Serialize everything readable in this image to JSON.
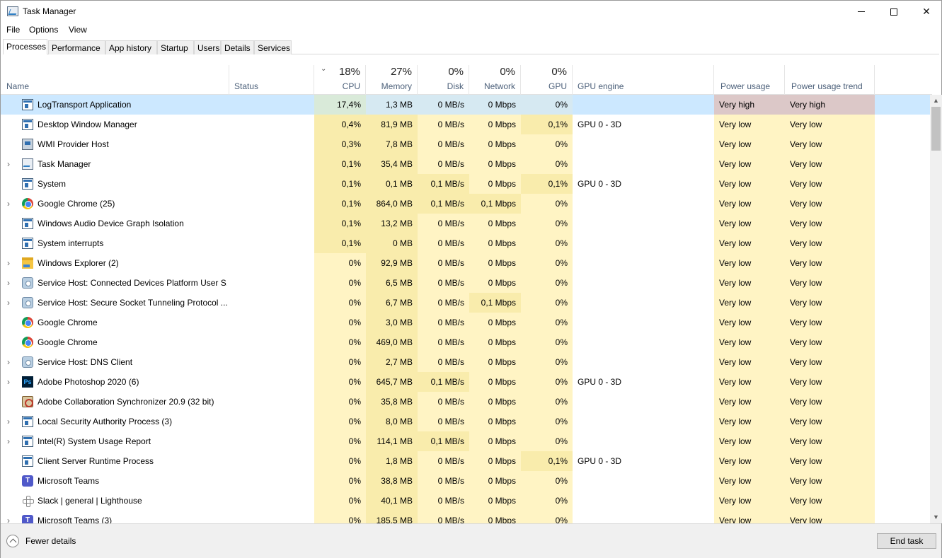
{
  "window": {
    "title": "Task Manager"
  },
  "menu": {
    "file": "File",
    "options": "Options",
    "view": "View"
  },
  "tabs": [
    "Processes",
    "Performance",
    "App history",
    "Startup",
    "Users",
    "Details",
    "Services"
  ],
  "header": {
    "name": "Name",
    "status": "Status",
    "cpu_pct": "18%",
    "cpu": "CPU",
    "memory_pct": "27%",
    "memory": "Memory",
    "disk_pct": "0%",
    "disk": "Disk",
    "network_pct": "0%",
    "network": "Network",
    "gpu_pct": "0%",
    "gpu": "GPU",
    "gpu_engine": "GPU engine",
    "power_usage": "Power usage",
    "power_usage_trend": "Power usage trend"
  },
  "processes": [
    {
      "name": "LogTransport Application",
      "icon": "app-icon",
      "expandable": false,
      "cpu": "17,4%",
      "memory": "1,3 MB",
      "disk": "0 MB/s",
      "network": "0 Mbps",
      "gpu": "0%",
      "gpu_engine": "",
      "power": "Very high",
      "trend": "Very high"
    },
    {
      "name": "Desktop Window Manager",
      "icon": "app-icon",
      "expandable": false,
      "cpu": "0,4%",
      "memory": "81,9 MB",
      "disk": "0 MB/s",
      "network": "0 Mbps",
      "gpu": "0,1%",
      "gpu_engine": "GPU 0 - 3D",
      "power": "Very low",
      "trend": "Very low"
    },
    {
      "name": "WMI Provider Host",
      "icon": "wmi-icon",
      "expandable": false,
      "cpu": "0,3%",
      "memory": "7,8 MB",
      "disk": "0 MB/s",
      "network": "0 Mbps",
      "gpu": "0%",
      "gpu_engine": "",
      "power": "Very low",
      "trend": "Very low"
    },
    {
      "name": "Task Manager",
      "icon": "task-manager-icon",
      "expandable": true,
      "cpu": "0,1%",
      "memory": "35,4 MB",
      "disk": "0 MB/s",
      "network": "0 Mbps",
      "gpu": "0%",
      "gpu_engine": "",
      "power": "Very low",
      "trend": "Very low"
    },
    {
      "name": "System",
      "icon": "app-icon",
      "expandable": false,
      "cpu": "0,1%",
      "memory": "0,1 MB",
      "disk": "0,1 MB/s",
      "network": "0 Mbps",
      "gpu": "0,1%",
      "gpu_engine": "GPU 0 - 3D",
      "power": "Very low",
      "trend": "Very low"
    },
    {
      "name": "Google Chrome (25)",
      "icon": "chrome-icon",
      "expandable": true,
      "cpu": "0,1%",
      "memory": "864,0 MB",
      "disk": "0,1 MB/s",
      "network": "0,1 Mbps",
      "gpu": "0%",
      "gpu_engine": "",
      "power": "Very low",
      "trend": "Very low"
    },
    {
      "name": "Windows Audio Device Graph Isolation",
      "icon": "app-icon",
      "expandable": false,
      "cpu": "0,1%",
      "memory": "13,2 MB",
      "disk": "0 MB/s",
      "network": "0 Mbps",
      "gpu": "0%",
      "gpu_engine": "",
      "power": "Very low",
      "trend": "Very low"
    },
    {
      "name": "System interrupts",
      "icon": "app-icon",
      "expandable": false,
      "cpu": "0,1%",
      "memory": "0 MB",
      "disk": "0 MB/s",
      "network": "0 Mbps",
      "gpu": "0%",
      "gpu_engine": "",
      "power": "Very low",
      "trend": "Very low"
    },
    {
      "name": "Windows Explorer (2)",
      "icon": "folder-icon",
      "expandable": true,
      "cpu": "0%",
      "memory": "92,9 MB",
      "disk": "0 MB/s",
      "network": "0 Mbps",
      "gpu": "0%",
      "gpu_engine": "",
      "power": "Very low",
      "trend": "Very low"
    },
    {
      "name": "Service Host: Connected Devices Platform User S...",
      "icon": "gear-icon",
      "expandable": true,
      "cpu": "0%",
      "memory": "6,5 MB",
      "disk": "0 MB/s",
      "network": "0 Mbps",
      "gpu": "0%",
      "gpu_engine": "",
      "power": "Very low",
      "trend": "Very low"
    },
    {
      "name": "Service Host: Secure Socket Tunneling Protocol ...",
      "icon": "gear-icon",
      "expandable": true,
      "cpu": "0%",
      "memory": "6,7 MB",
      "disk": "0 MB/s",
      "network": "0,1 Mbps",
      "gpu": "0%",
      "gpu_engine": "",
      "power": "Very low",
      "trend": "Very low"
    },
    {
      "name": "Google Chrome",
      "icon": "chrome-icon",
      "expandable": false,
      "cpu": "0%",
      "memory": "3,0 MB",
      "disk": "0 MB/s",
      "network": "0 Mbps",
      "gpu": "0%",
      "gpu_engine": "",
      "power": "Very low",
      "trend": "Very low"
    },
    {
      "name": "Google Chrome",
      "icon": "chrome-icon",
      "expandable": false,
      "cpu": "0%",
      "memory": "469,0 MB",
      "disk": "0 MB/s",
      "network": "0 Mbps",
      "gpu": "0%",
      "gpu_engine": "",
      "power": "Very low",
      "trend": "Very low"
    },
    {
      "name": "Service Host: DNS Client",
      "icon": "gear-icon",
      "expandable": true,
      "cpu": "0%",
      "memory": "2,7 MB",
      "disk": "0 MB/s",
      "network": "0 Mbps",
      "gpu": "0%",
      "gpu_engine": "",
      "power": "Very low",
      "trend": "Very low"
    },
    {
      "name": "Adobe Photoshop 2020 (6)",
      "icon": "photoshop-icon",
      "expandable": true,
      "cpu": "0%",
      "memory": "645,7 MB",
      "disk": "0,1 MB/s",
      "network": "0 Mbps",
      "gpu": "0%",
      "gpu_engine": "GPU 0 - 3D",
      "power": "Very low",
      "trend": "Very low"
    },
    {
      "name": "Adobe Collaboration Synchronizer 20.9 (32 bit)",
      "icon": "sync-icon",
      "expandable": false,
      "cpu": "0%",
      "memory": "35,8 MB",
      "disk": "0 MB/s",
      "network": "0 Mbps",
      "gpu": "0%",
      "gpu_engine": "",
      "power": "Very low",
      "trend": "Very low"
    },
    {
      "name": "Local Security Authority Process (3)",
      "icon": "app-icon",
      "expandable": true,
      "cpu": "0%",
      "memory": "8,0 MB",
      "disk": "0 MB/s",
      "network": "0 Mbps",
      "gpu": "0%",
      "gpu_engine": "",
      "power": "Very low",
      "trend": "Very low"
    },
    {
      "name": "Intel(R) System Usage Report",
      "icon": "app-icon",
      "expandable": true,
      "cpu": "0%",
      "memory": "114,1 MB",
      "disk": "0,1 MB/s",
      "network": "0 Mbps",
      "gpu": "0%",
      "gpu_engine": "",
      "power": "Very low",
      "trend": "Very low"
    },
    {
      "name": "Client Server Runtime Process",
      "icon": "app-icon",
      "expandable": false,
      "cpu": "0%",
      "memory": "1,8 MB",
      "disk": "0 MB/s",
      "network": "0 Mbps",
      "gpu": "0,1%",
      "gpu_engine": "GPU 0 - 3D",
      "power": "Very low",
      "trend": "Very low"
    },
    {
      "name": "Microsoft Teams",
      "icon": "teams-icon",
      "expandable": false,
      "cpu": "0%",
      "memory": "38,8 MB",
      "disk": "0 MB/s",
      "network": "0 Mbps",
      "gpu": "0%",
      "gpu_engine": "",
      "power": "Very low",
      "trend": "Very low"
    },
    {
      "name": "Slack | general | Lighthouse",
      "icon": "slack-icon",
      "expandable": false,
      "cpu": "0%",
      "memory": "40,1 MB",
      "disk": "0 MB/s",
      "network": "0 Mbps",
      "gpu": "0%",
      "gpu_engine": "",
      "power": "Very low",
      "trend": "Very low"
    },
    {
      "name": "Microsoft Teams (3)",
      "icon": "teams-icon",
      "expandable": true,
      "cpu": "0%",
      "memory": "185,5 MB",
      "disk": "0 MB/s",
      "network": "0 Mbps",
      "gpu": "0%",
      "gpu_engine": "",
      "power": "Very low",
      "trend": "Very low"
    }
  ],
  "footer": {
    "fewer_details": "Fewer details",
    "end_task": "End task"
  },
  "colors": {
    "selected_row": "#cce8ff",
    "heat_light": "#fff4c4",
    "heat_medium": "#f9ecac",
    "power_high": "#dcc3c3",
    "header_label": "#4c607a"
  }
}
